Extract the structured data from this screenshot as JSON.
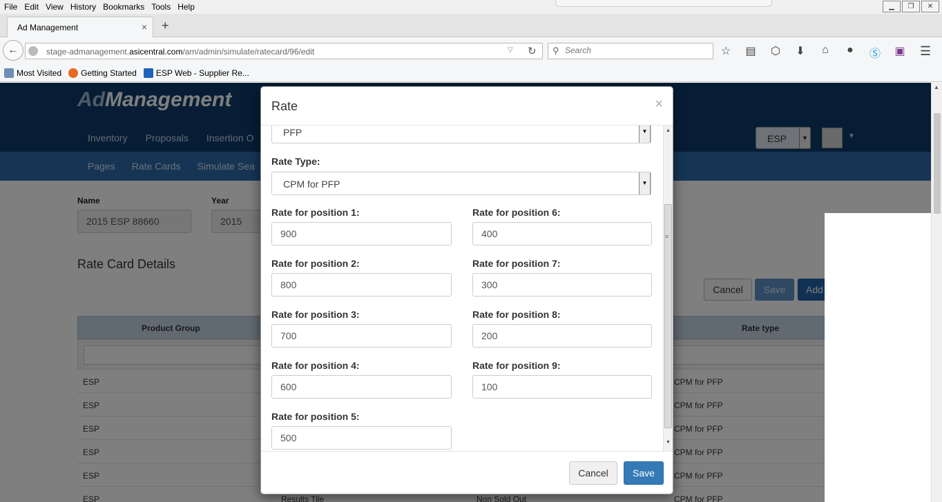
{
  "browser": {
    "menu": [
      "File",
      "Edit",
      "View",
      "History",
      "Bookmarks",
      "Tools",
      "Help"
    ],
    "window_controls": [
      "▁",
      "❐",
      "✕"
    ],
    "tab_title": "Ad Management",
    "tab_close": "×",
    "new_tab": "+",
    "url_host_prefix": "stage-admanagement.",
    "url_host_domain": "asicentral.com",
    "url_path": "/am/admin/simulate/ratecard/96/edit",
    "search_placeholder": "Search",
    "bookmarks": [
      "Most Visited",
      "Getting Started",
      "ESP Web - Supplier Re..."
    ],
    "toolbar_icons": [
      "star-icon",
      "reading-list-icon",
      "pocket-icon",
      "download-icon",
      "home-icon",
      "chat-icon",
      "skype-icon",
      "extension-icon"
    ]
  },
  "app": {
    "logo_ad": "Ad",
    "logo_rest": "Management",
    "topnav": [
      "Inventory",
      "Proposals",
      "Insertion O"
    ],
    "subnav": [
      "Pages",
      "Rate Cards",
      "Simulate Sea"
    ],
    "esp_selector": "ESP",
    "form": {
      "name_label": "Name",
      "name_value": "2015 ESP 88660",
      "year_label": "Year",
      "year_value": "2015"
    },
    "section_title": "Rate Card Details",
    "buttons": {
      "cancel": "Cancel",
      "save": "Save",
      "add": "Add"
    },
    "grid": {
      "columns": {
        "product_group": "Product Group",
        "rate_type": "Rate type"
      },
      "rows": [
        {
          "product_group": "ESP",
          "rate_type": "CPM for PFP"
        },
        {
          "product_group": "ESP",
          "rate_type": "CPM for PFP"
        },
        {
          "product_group": "ESP",
          "rate_type": "CPM for PFP"
        },
        {
          "product_group": "ESP",
          "rate_type": "CPM for PFP"
        },
        {
          "product_group": "ESP",
          "rate_type": "CPM for PFP"
        }
      ],
      "partial_row": {
        "product_group": "ESP",
        "middle1": "Results Tile",
        "middle2": "Non Sold Out",
        "rate_type": "CPM for PFP"
      }
    }
  },
  "modal": {
    "title": "Rate",
    "close": "×",
    "top_select_value": "PFP",
    "rate_type_label": "Rate Type:",
    "rate_type_value": "CPM for PFP",
    "positions_left": [
      {
        "label": "Rate for position 1:",
        "value": "900"
      },
      {
        "label": "Rate for position 2:",
        "value": "800"
      },
      {
        "label": "Rate for position 3:",
        "value": "700"
      },
      {
        "label": "Rate for position 4:",
        "value": "600"
      },
      {
        "label": "Rate for position 5:",
        "value": "500"
      }
    ],
    "positions_right": [
      {
        "label": "Rate for position 6:",
        "value": "400"
      },
      {
        "label": "Rate for position 7:",
        "value": "300"
      },
      {
        "label": "Rate for position 8:",
        "value": "200"
      },
      {
        "label": "Rate for position 9:",
        "value": "100"
      }
    ],
    "cancel_label": "Cancel",
    "save_label": "Save"
  }
}
